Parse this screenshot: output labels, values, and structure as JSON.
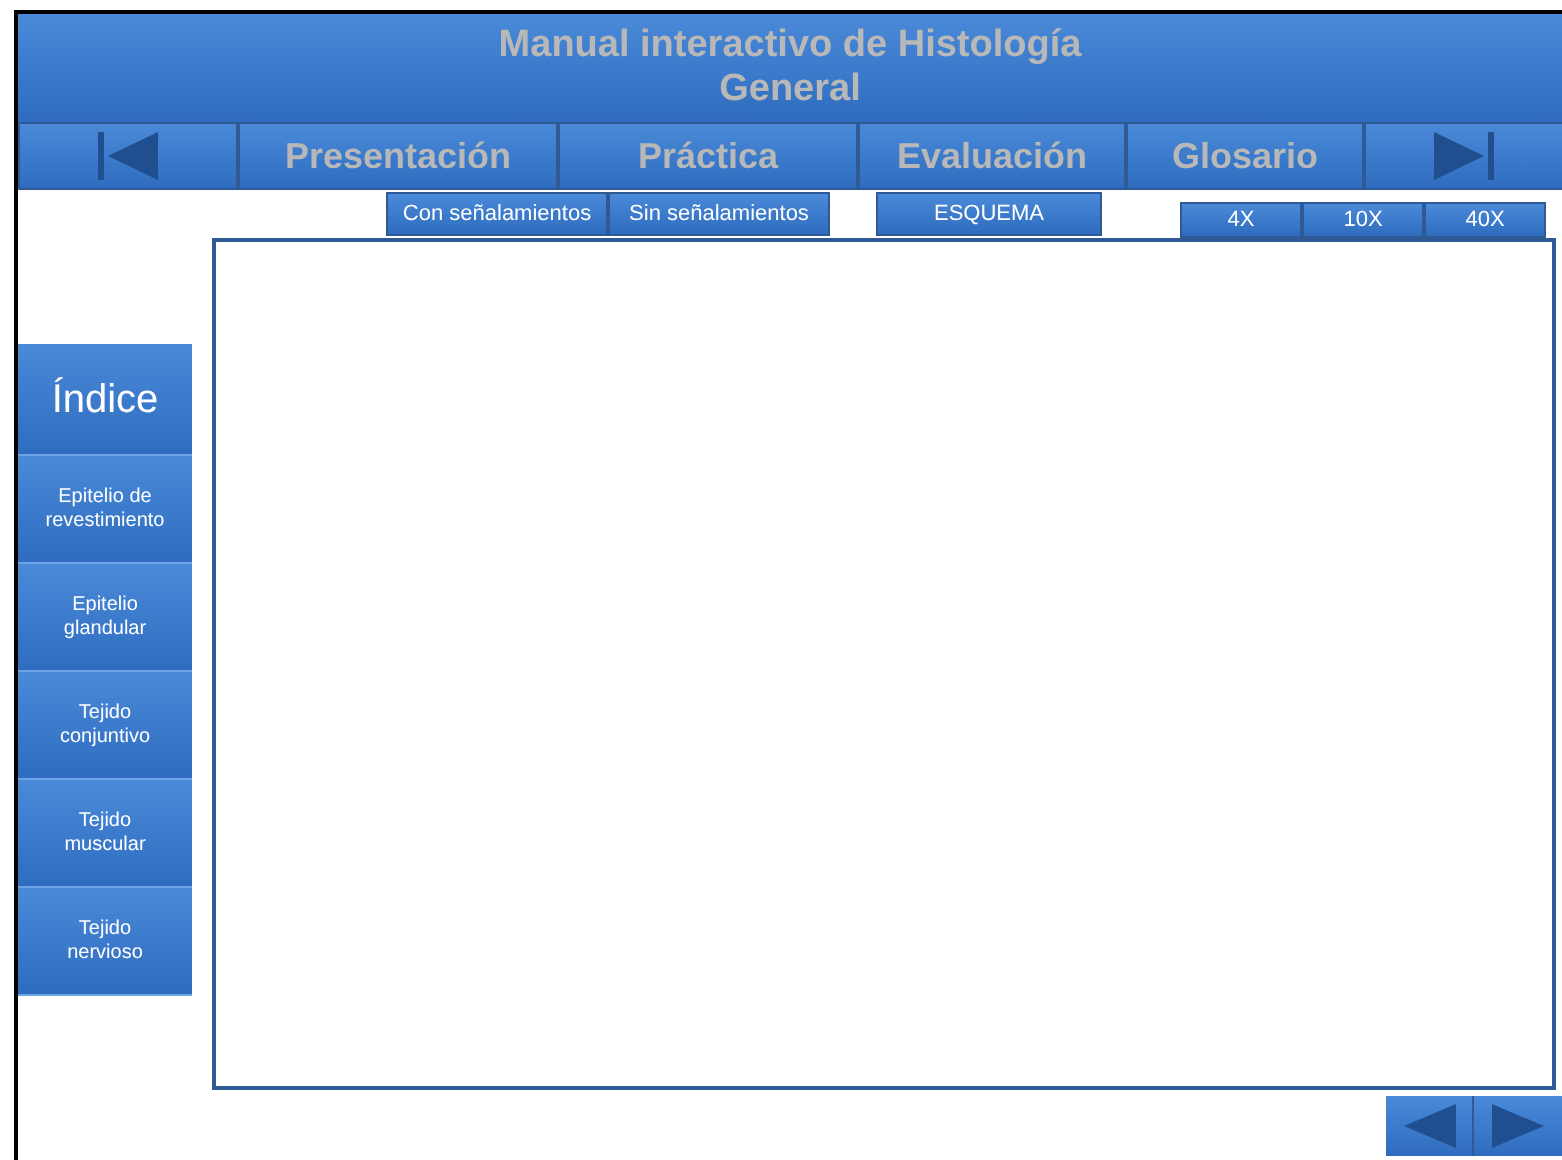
{
  "header": {
    "title_lines": [
      "Manual interactivo de Histología",
      "General"
    ]
  },
  "nav": {
    "items": [
      {
        "kind": "prev"
      },
      {
        "kind": "tab",
        "label": "Presentación"
      },
      {
        "kind": "tab",
        "label": "Práctica"
      },
      {
        "kind": "tab",
        "label": "Evaluación"
      },
      {
        "kind": "tab",
        "label": "Glosario"
      },
      {
        "kind": "next"
      }
    ]
  },
  "view_buttons": [
    "Con señalamientos",
    "Sin señalamientos",
    "ESQUEMA"
  ],
  "zoom_buttons": [
    "4X",
    "10X",
    "40X"
  ],
  "sidebar": {
    "title": "Índice",
    "items": [
      [
        "Epitelio de",
        "revestimiento"
      ],
      [
        "Epitelio",
        "glandular"
      ],
      [
        "Tejido",
        "conjuntivo"
      ],
      [
        "Tejido",
        "muscular"
      ],
      [
        "Tejido",
        "nervioso"
      ]
    ]
  }
}
